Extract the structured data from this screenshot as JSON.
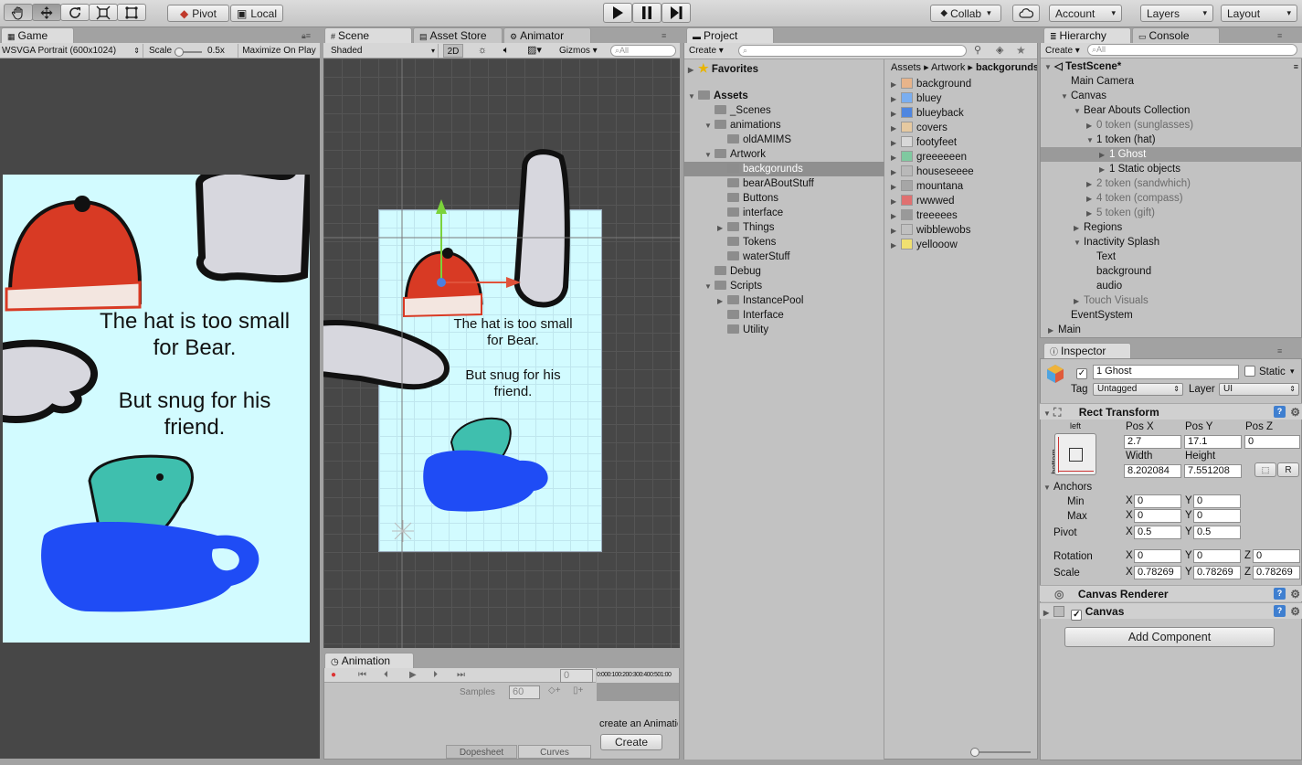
{
  "toolbar": {
    "pivot": "Pivot",
    "local": "Local",
    "collab": "Collab",
    "account": "Account",
    "layers": "Layers",
    "layout": "Layout",
    "tools": [
      "hand-tool-icon",
      "move-tool-icon",
      "rotate-tool-icon",
      "scale-tool-icon",
      "rect-tool-icon"
    ]
  },
  "game": {
    "tab": "Game",
    "resolution": "WSVGA Portrait (600x1024)",
    "scale_label": "Scale",
    "scale_value": "0.5x",
    "maximize": "Maximize On Play",
    "text1": "The hat is too small for Bear.",
    "text2": "But snug for his friend."
  },
  "scene": {
    "tabs": [
      "Scene",
      "Asset Store",
      "Animator"
    ],
    "shading": "Shaded",
    "mode2d": "2D",
    "gizmos": "Gizmos",
    "search_placeholder": "All",
    "text1": "The hat is too small for Bear.",
    "text2": "But snug for his friend."
  },
  "animation": {
    "tab": "Animation",
    "frame": "0",
    "samples_label": "Samples",
    "samples_value": "60",
    "ticks": [
      "0:00",
      "0:10",
      "0:20",
      "0:30",
      "0:40",
      "0:50",
      "1:00"
    ],
    "create_text": "create an Animation",
    "create_button": "Create",
    "dopesheet": "Dopesheet",
    "curves": "Curves"
  },
  "project": {
    "tab": "Project",
    "create": "Create",
    "favorites": "Favorites",
    "assets": "Assets",
    "tree": [
      {
        "label": "_Scenes",
        "depth": 1,
        "arrow": ""
      },
      {
        "label": "animations",
        "depth": 1,
        "arrow": "▼"
      },
      {
        "label": "oldAMIMS",
        "depth": 2,
        "arrow": ""
      },
      {
        "label": "Artwork",
        "depth": 1,
        "arrow": "▼"
      },
      {
        "label": "backgorunds",
        "depth": 2,
        "arrow": "",
        "selected": true
      },
      {
        "label": "bearABoutStuff",
        "depth": 2,
        "arrow": ""
      },
      {
        "label": "Buttons",
        "depth": 2,
        "arrow": ""
      },
      {
        "label": "interface",
        "depth": 2,
        "arrow": ""
      },
      {
        "label": "Things",
        "depth": 2,
        "arrow": "▶"
      },
      {
        "label": "Tokens",
        "depth": 2,
        "arrow": ""
      },
      {
        "label": "waterStuff",
        "depth": 2,
        "arrow": ""
      },
      {
        "label": "Debug",
        "depth": 1,
        "arrow": ""
      },
      {
        "label": "Scripts",
        "depth": 1,
        "arrow": "▼"
      },
      {
        "label": "InstancePool",
        "depth": 2,
        "arrow": "▶"
      },
      {
        "label": "Interface",
        "depth": 2,
        "arrow": ""
      },
      {
        "label": "Utility",
        "depth": 2,
        "arrow": ""
      }
    ],
    "breadcrumb": [
      "Assets",
      "Artwork",
      "backgorunds"
    ],
    "files": [
      {
        "label": "background",
        "color": "#e8b48a"
      },
      {
        "label": "bluey",
        "color": "#7aaef0"
      },
      {
        "label": "blueyback",
        "color": "#4f86e0"
      },
      {
        "label": "covers",
        "color": "#e6c9a0"
      },
      {
        "label": "footyfeet",
        "color": "#d8d8d8"
      },
      {
        "label": "greeeeeen",
        "color": "#7fc9a0"
      },
      {
        "label": "houseseeee",
        "color": "#b9b9b9"
      },
      {
        "label": "mountana",
        "color": "#a6a6a6"
      },
      {
        "label": "rwwwed",
        "color": "#e07070"
      },
      {
        "label": "treeeees",
        "color": "#999999"
      },
      {
        "label": "wibblewobs",
        "color": "#c0c0c0"
      },
      {
        "label": "yellooow",
        "color": "#f0e070"
      }
    ]
  },
  "hierarchy": {
    "tab": "Hierarchy",
    "console": "Console",
    "create": "Create",
    "search_placeholder": "All",
    "scene": "TestScene*",
    "items": [
      {
        "label": "Main Camera",
        "depth": 1,
        "arrow": "",
        "gray": false
      },
      {
        "label": "Canvas",
        "depth": 1,
        "arrow": "▼",
        "gray": false
      },
      {
        "label": "Bear Abouts Collection",
        "depth": 2,
        "arrow": "▼",
        "gray": false
      },
      {
        "label": "0 token (sunglasses)",
        "depth": 3,
        "arrow": "▶",
        "gray": true
      },
      {
        "label": "1 token (hat)",
        "depth": 3,
        "arrow": "▼",
        "gray": false
      },
      {
        "label": "1 Ghost",
        "depth": 4,
        "arrow": "▶",
        "gray": false,
        "selected": true
      },
      {
        "label": "1 Static objects",
        "depth": 4,
        "arrow": "▶",
        "gray": false
      },
      {
        "label": "2 token (sandwhich)",
        "depth": 3,
        "arrow": "▶",
        "gray": true
      },
      {
        "label": "4 token (compass)",
        "depth": 3,
        "arrow": "▶",
        "gray": true
      },
      {
        "label": "5 token (gift)",
        "depth": 3,
        "arrow": "▶",
        "gray": true
      },
      {
        "label": "Regions",
        "depth": 2,
        "arrow": "▶",
        "gray": false
      },
      {
        "label": "Inactivity Splash",
        "depth": 2,
        "arrow": "▼",
        "gray": false
      },
      {
        "label": "Text",
        "depth": 3,
        "arrow": "",
        "gray": false
      },
      {
        "label": "background",
        "depth": 3,
        "arrow": "",
        "gray": false
      },
      {
        "label": "audio",
        "depth": 3,
        "arrow": "",
        "gray": false
      },
      {
        "label": "Touch Visuals",
        "depth": 2,
        "arrow": "▶",
        "gray": true
      },
      {
        "label": "EventSystem",
        "depth": 1,
        "arrow": "",
        "gray": false
      },
      {
        "label": "Main",
        "depth": 0,
        "arrow": "▶",
        "gray": false
      }
    ]
  },
  "inspector": {
    "tab": "Inspector",
    "name": "1 Ghost",
    "static_label": "Static",
    "tag_label": "Tag",
    "tag_value": "Untagged",
    "layer_label": "Layer",
    "layer_value": "UI",
    "rect_title": "Rect Transform",
    "anchor_left": "left",
    "anchor_bottom": "bottom",
    "pos_labels": [
      "Pos X",
      "Pos Y",
      "Pos Z"
    ],
    "pos_values": [
      "2.7",
      "17.1",
      "0"
    ],
    "size_labels": [
      "Width",
      "Height"
    ],
    "size_values": [
      "8.202084",
      "7.551208"
    ],
    "r_button": "R",
    "anchors": "Anchors",
    "min": "Min",
    "max": "Max",
    "pivot": "Pivot",
    "axis_x": "X",
    "axis_y": "Y",
    "axis_z": "Z",
    "min_values": [
      "0",
      "0"
    ],
    "max_values": [
      "0",
      "0"
    ],
    "pivot_values": [
      "0.5",
      "0.5"
    ],
    "rotation": "Rotation",
    "rotation_values": [
      "0",
      "0",
      "0"
    ],
    "scale": "Scale",
    "scale_values": [
      "0.78269",
      "0.78269",
      "0.78269"
    ],
    "canvas_renderer": "Canvas Renderer",
    "canvas": "Canvas",
    "add_component": "Add Component"
  }
}
